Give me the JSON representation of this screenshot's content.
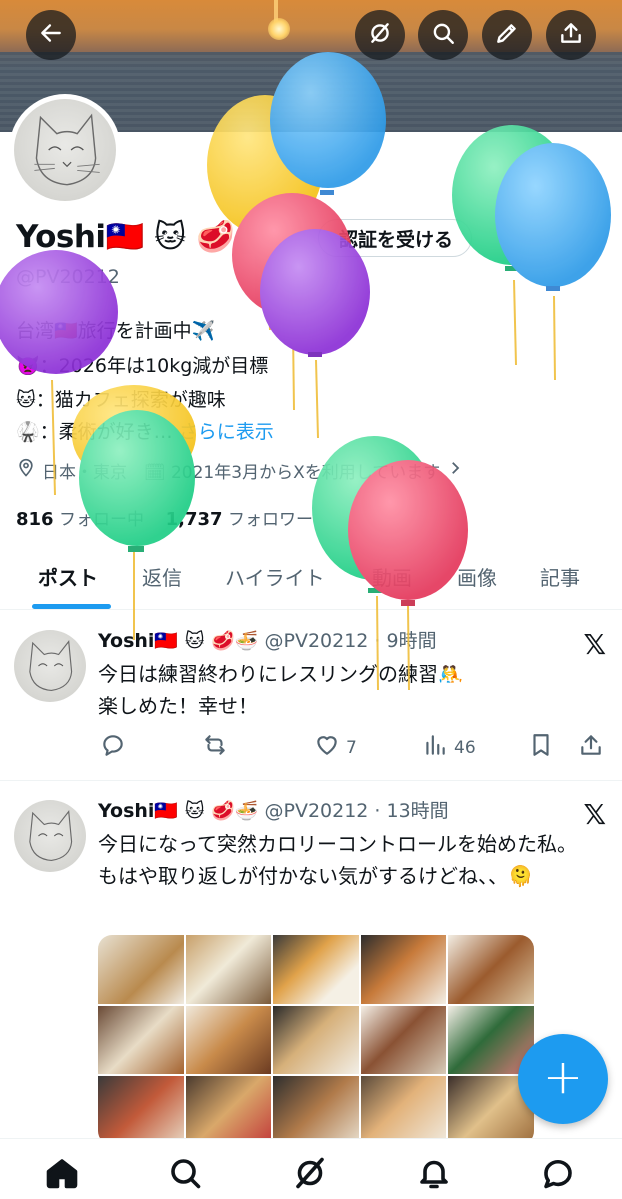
{
  "profile": {
    "name": "Yoshi🇹🇼 🐱 🥩",
    "handle": "@PV20212",
    "verify_button": "認証を受ける",
    "bio_lines": [
      "台湾🇹🇼旅行を計画中✈️",
      "👿：2026年は10kg減が目標",
      "🐱：猫カフェ探索が趣味",
      "🥋：柔術が好き…"
    ],
    "show_more": "さらに表示",
    "meta": "日本・東京　🗓 2021年3月からXを利用しています",
    "following_count": "816",
    "following_label": "フォロー中",
    "followers_count": "1,737",
    "followers_label": "フォロワー"
  },
  "tabs": [
    "ポスト",
    "返信",
    "ハイライト",
    "動画",
    "画像",
    "記事"
  ],
  "posts": [
    {
      "author": "Yoshi🇹🇼 🐱 🥩🍜",
      "meta": "@PV20212 · 9時間",
      "text": "今日は練習終わりにレスリングの練習🤼\n楽しめた！幸せ！",
      "likes": "7",
      "views": "46"
    },
    {
      "author": "Yoshi🇹🇼 🐱 🥩🍜",
      "meta": "@PV20212 · 13時間",
      "text": "今日になって突然カロリーコントロールを始めた私。もはや取り返しが付かない気がするけどね、、🫠"
    }
  ],
  "fab_label": "+",
  "icons": {
    "header": [
      "back-arrow-icon",
      "grok-icon",
      "search-icon",
      "edit-icon",
      "share-icon"
    ],
    "nav": [
      "home-icon",
      "search-icon",
      "grok-icon",
      "notifications-icon",
      "messages-icon"
    ]
  },
  "colors": {
    "accent": "#1d9bf0",
    "text": "#0f1419",
    "secondary": "#536471"
  }
}
